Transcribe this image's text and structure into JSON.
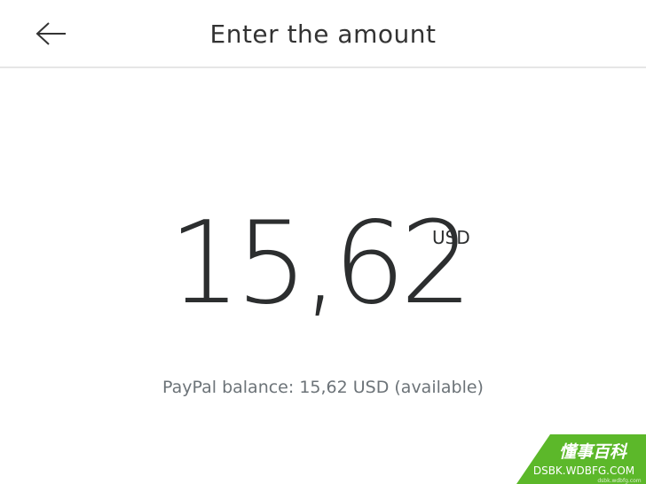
{
  "header": {
    "title": "Enter the amount",
    "back_icon": "arrow-left-icon"
  },
  "amount": {
    "value": "15,62",
    "currency": "USD"
  },
  "balance": {
    "text": "PayPal balance: 15,62 USD (available)"
  },
  "watermark": {
    "brand_text": "懂事百科",
    "domain": "DSBK.WDBFG.COM",
    "small_text": "dsbk.wdbfg.com",
    "color": "#5cb82a"
  },
  "colors": {
    "text_primary": "#2c2e2f",
    "text_secondary": "#6c7378",
    "divider": "#e6e6e6"
  }
}
